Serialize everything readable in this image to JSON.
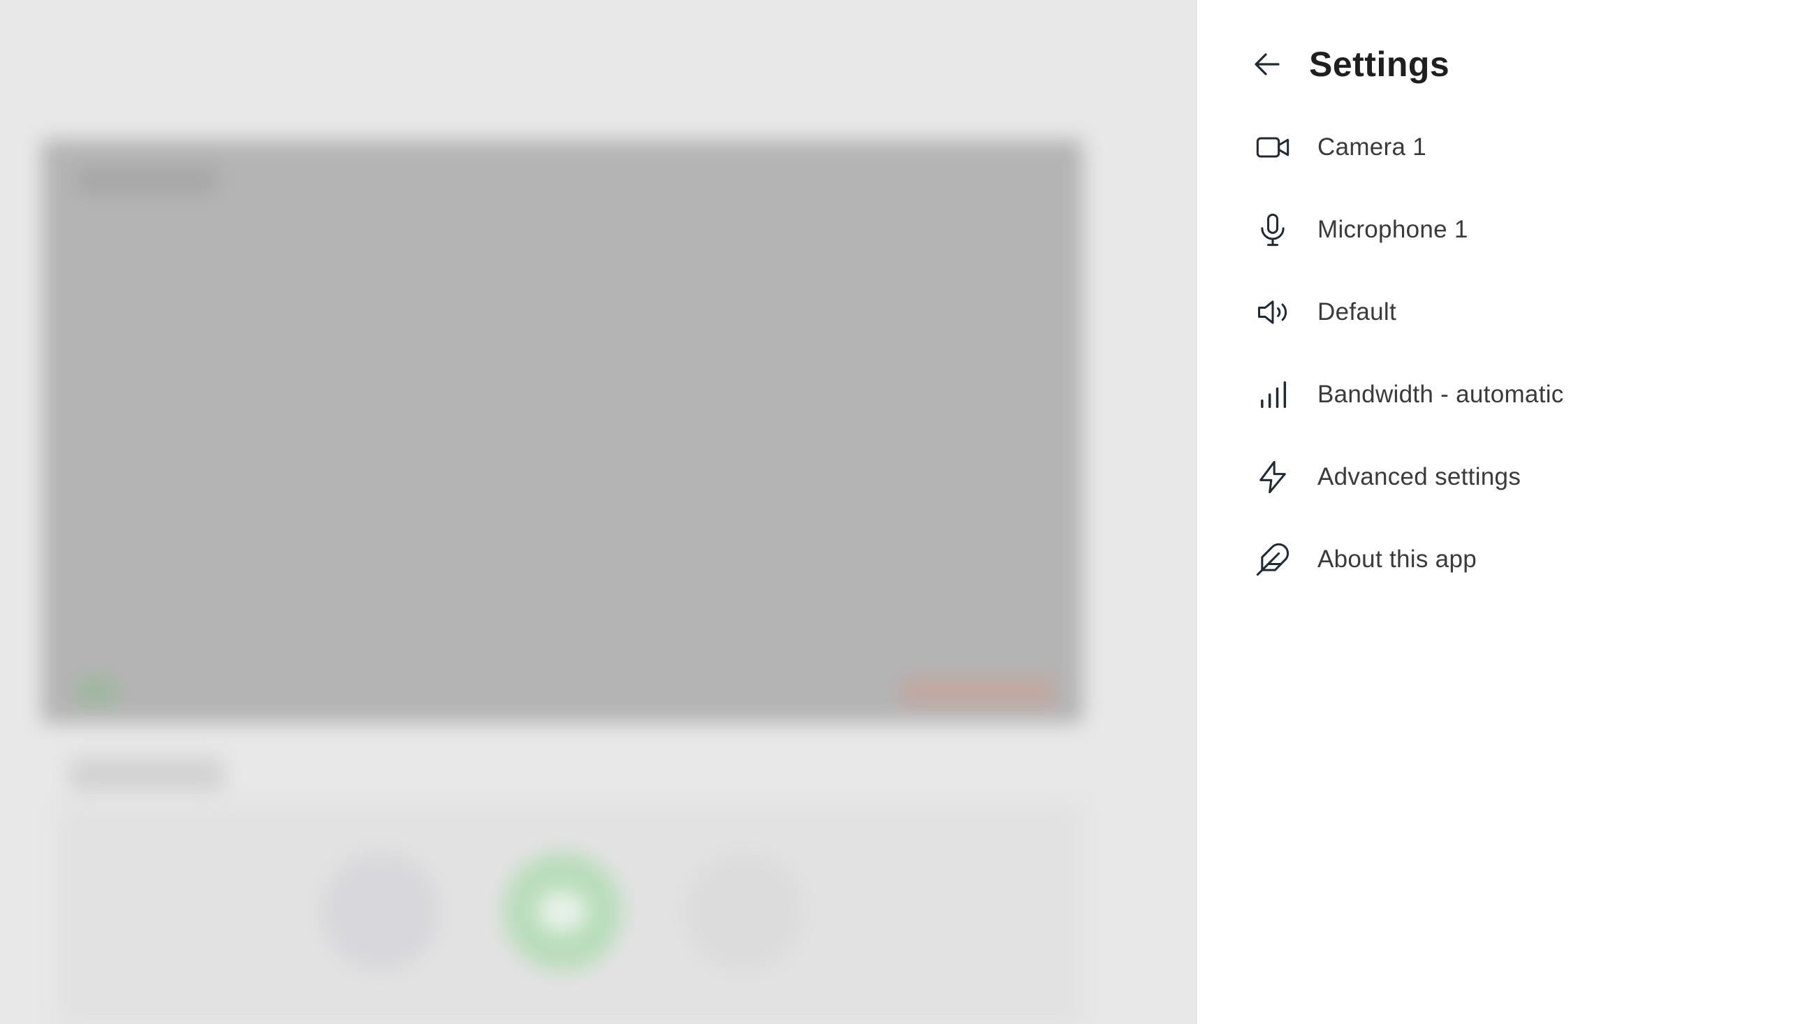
{
  "settings": {
    "title": "Settings",
    "back_icon": "arrow-left-icon",
    "items": [
      {
        "label": "Camera 1",
        "icon": "video-camera-icon"
      },
      {
        "label": "Microphone 1",
        "icon": "microphone-icon"
      },
      {
        "label": "Default",
        "icon": "speaker-icon"
      },
      {
        "label": "Bandwidth - automatic",
        "icon": "signal-bars-icon"
      },
      {
        "label": "Advanced settings",
        "icon": "lightning-icon"
      },
      {
        "label": "About this app",
        "icon": "feather-icon"
      }
    ]
  },
  "colors": {
    "drawer_background": "#ffffff",
    "overlay_background": "#e8e8e8",
    "title_text": "#1f1f1f",
    "item_text": "#3a3a3a",
    "icon_stroke": "#1f2a37"
  }
}
